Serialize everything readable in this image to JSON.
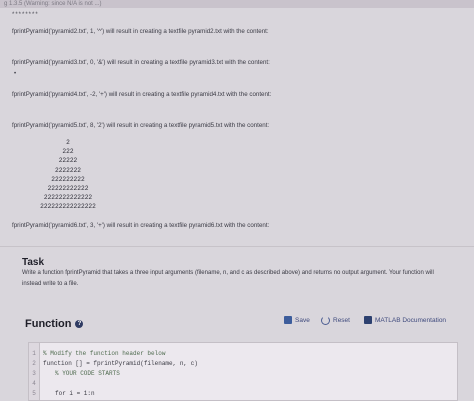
{
  "header": {
    "partial_text": "g 1.3.5 (Warning: since N/A is not ...)"
  },
  "examples": {
    "stars": "********",
    "dot": "•",
    "line1": "fprintPyramid('pyramid2.txt', 1, '^') will result in creating a textfile pyramid2.txt with the content:",
    "line2": "fprintPyramid('pyramid3.txt', 0, '&') will result in creating a textfile pyramid3.txt with the content:",
    "line3": "fprintPyramid('pyramid4.txt', -2, '+') will result in creating a textfile pyramid4.txt with the content:",
    "line4": "fprintPyramid('pyramid5.txt', 8, '2') will result in creating a textfile pyramid5.txt with the content:",
    "pyramid": [
      "2",
      "222",
      "22222",
      "2222222",
      "222222222",
      "22222222222",
      "2222222222222",
      "222222222222222"
    ],
    "line5": "fprintPyramid('pyramid6.txt', 3, '+') will result in creating a textfile pyramid6.txt with the content:"
  },
  "task": {
    "title": "Task",
    "description": "Write a function fprintPyramid that takes a three input arguments (filename, n, and c as described above) and returns no output argument. Your function will instead write to a file."
  },
  "function_panel": {
    "title": "Function",
    "info_icon": "?",
    "save_label": "Save",
    "reset_label": "Reset",
    "docs_label": "MATLAB Documentation"
  },
  "editor": {
    "lines": [
      {
        "num": "1",
        "text": "% Modify the function header below"
      },
      {
        "num": "2",
        "text": "function [] = fprintPyramid(filename, n, c)"
      },
      {
        "num": "3",
        "text": "% YOUR CODE STARTS"
      },
      {
        "num": "4",
        "text": ""
      },
      {
        "num": "5",
        "text": "for i = 1:n"
      }
    ]
  }
}
